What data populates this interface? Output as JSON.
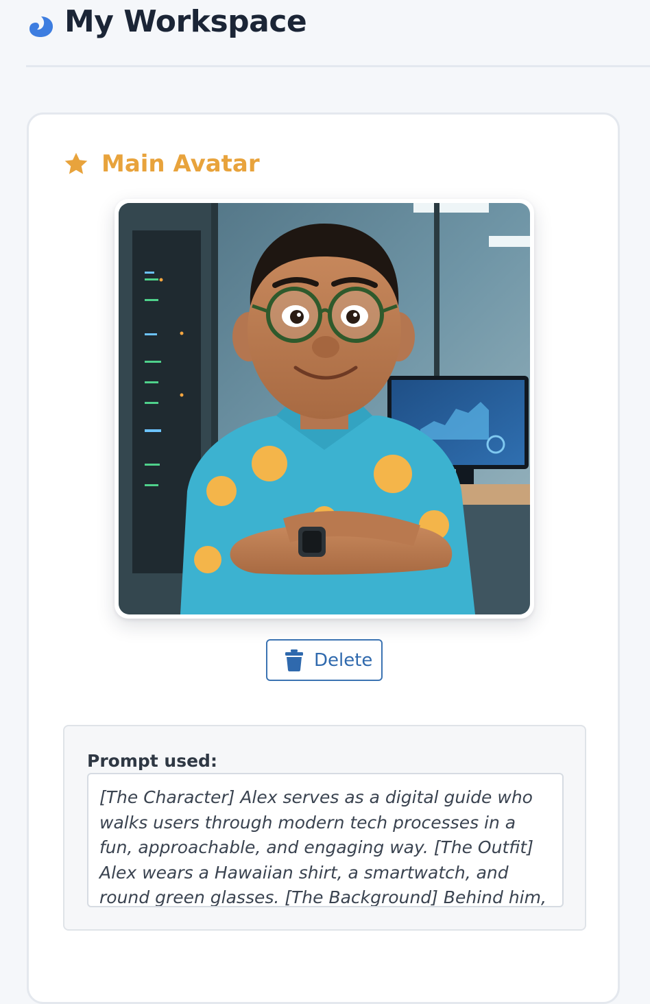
{
  "header": {
    "title": "My Workspace",
    "logo_icon": "blue-leaf-logo-icon"
  },
  "avatar_section": {
    "title": "Main Avatar",
    "star_icon": "star-icon",
    "accent_color": "#e8a33c",
    "image_alt": "Main Avatar",
    "delete_label": "Delete",
    "delete_icon": "trash-icon"
  },
  "prompt": {
    "label": "Prompt used:",
    "text": "[The Character] Alex serves as a digital guide who walks users through modern tech processes in a fun, approachable, and engaging way. [The Outfit] Alex wears a Hawaiian shirt, a smartwatch, and round green glasses. [The Background] Behind him, large"
  },
  "colors": {
    "primary": "#2f69ad",
    "title_text": "#1b2536",
    "accent": "#e8a33c"
  }
}
